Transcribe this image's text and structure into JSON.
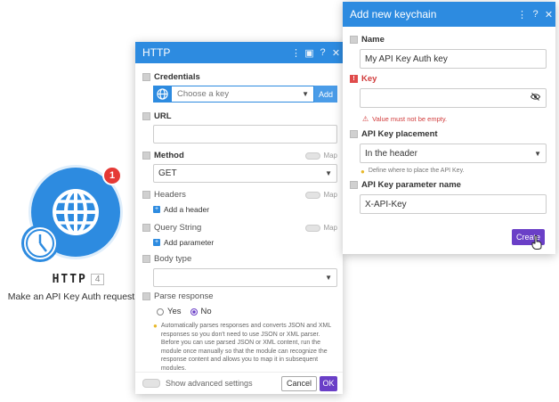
{
  "module": {
    "name": "HTTP",
    "number": "4",
    "description": "Make an API Key Auth request",
    "badge": "1"
  },
  "http_panel": {
    "title": "HTTP",
    "credentials": {
      "label": "Credentials",
      "placeholder": "Choose a key",
      "add_label": "Add"
    },
    "url": {
      "label": "URL",
      "value": ""
    },
    "method": {
      "label": "Method",
      "value": "GET",
      "map_label": "Map"
    },
    "headers": {
      "label": "Headers",
      "add_label": "Add a header",
      "map_label": "Map"
    },
    "query_string": {
      "label": "Query String",
      "add_label": "Add parameter",
      "map_label": "Map"
    },
    "body_type": {
      "label": "Body type",
      "value": ""
    },
    "parse_response": {
      "label": "Parse response",
      "options": [
        "Yes",
        "No"
      ],
      "selected": "No",
      "hint": "Automatically parses responses and converts JSON and XML responses so you don't need to use JSON or XML parser. Before you can use parsed JSON or XML content, run the module once manually so that the module can recognize the response content and allows you to map it in subsequent modules."
    },
    "footer": {
      "advanced_label": "Show advanced settings",
      "cancel_label": "Cancel",
      "ok_label": "OK"
    }
  },
  "keychain_panel": {
    "title": "Add new keychain",
    "name": {
      "label": "Name",
      "value": "My API Key Auth key"
    },
    "key": {
      "label": "Key",
      "value": "",
      "error": "Value must not be empty."
    },
    "placement": {
      "label": "API Key placement",
      "value": "In the header",
      "hint": "Define where to place the API Key."
    },
    "param_name": {
      "label": "API Key parameter name",
      "value": "X-API-Key"
    },
    "create_label": "Create"
  },
  "colors": {
    "accent_blue": "#2d8be0",
    "primary_purple": "#6a3fc7",
    "error_red": "#d13c3c",
    "badge_red": "#e53935"
  },
  "icons": {
    "module": "globe-icon",
    "clock": "clock-icon",
    "eye": "eye-off-icon",
    "hint": "lightbulb-icon"
  }
}
